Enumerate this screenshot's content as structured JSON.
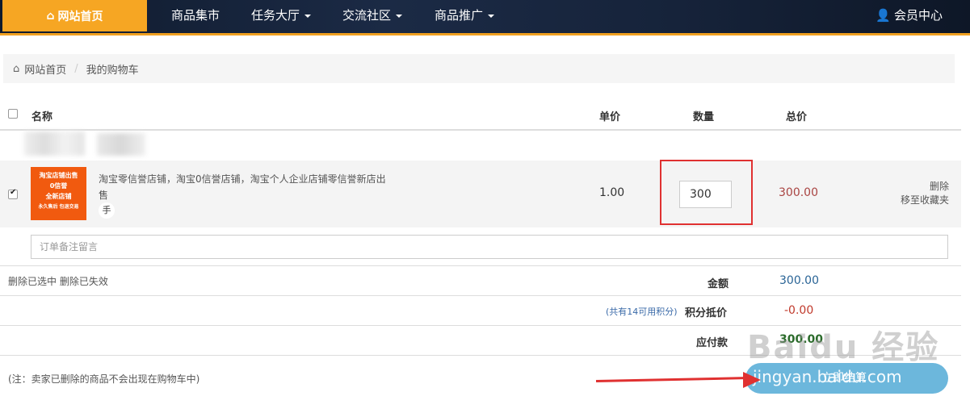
{
  "nav": {
    "home": "网站首页",
    "items": [
      "商品集市",
      "任务大厅",
      "交流社区",
      "商品推广"
    ],
    "member": "会员中心"
  },
  "breadcrumb": {
    "home": "网站首页",
    "current": "我的购物车"
  },
  "table_header": {
    "name": "名称",
    "unit_price": "单价",
    "quantity": "数量",
    "total": "总价"
  },
  "item": {
    "thumb_lines": [
      "淘宝店铺出售",
      "0信誉",
      "全新店铺",
      "永久售后  包退交易"
    ],
    "title": "淘宝零信誉店铺，淘宝0信誉店铺，淘宝个人企业店铺零信誉新店出售",
    "badge": "手",
    "price": "1.00",
    "quantity": "300",
    "total": "300.00",
    "delete": "删除",
    "move_to_favorites": "移至收藏夹"
  },
  "remark_placeholder": "订单备注留言",
  "summary": {
    "delete_links": "删除已选中 删除已失效",
    "amount_label": "金额",
    "amount": "300.00",
    "points_note": "(共有14可用积分)",
    "points_label": "积分抵价",
    "points_value": "-0.00",
    "payable_label": "应付款",
    "payable": "300.00"
  },
  "note": "(注：卖家已删除的商品不会出现在购物车中)",
  "checkout_label": "立即结算",
  "watermark": {
    "text": "Baidu 经验",
    "url": "jingyan.baidu.com"
  },
  "colors": {
    "accent": "#f6a623",
    "highlight_border": "#e03131",
    "checkout": "#6cb7dc"
  }
}
